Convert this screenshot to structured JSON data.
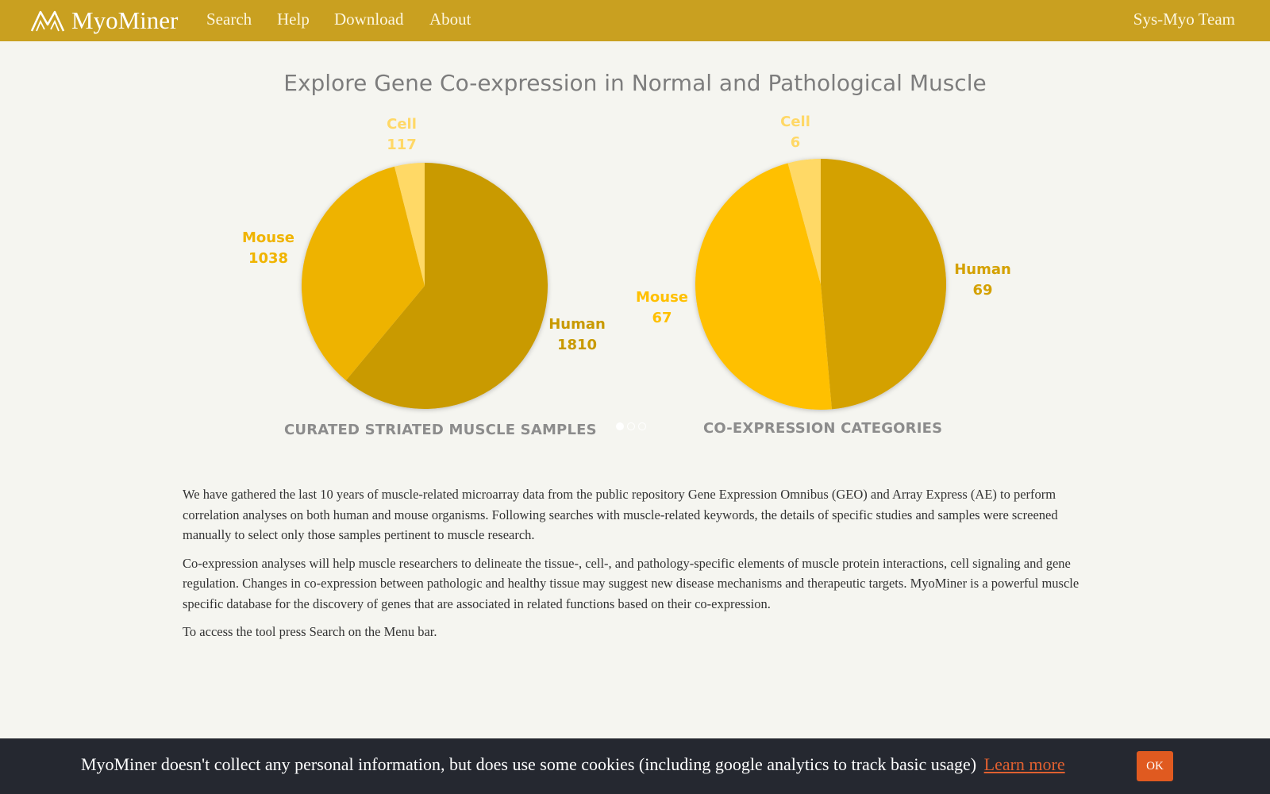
{
  "navbar": {
    "brand": "MyoMiner",
    "links": [
      "Search",
      "Help",
      "Download",
      "About"
    ],
    "team": "Sys-Myo Team"
  },
  "headline": "Explore Gene Co-expression in Normal and Pathological Muscle",
  "chart_data": [
    {
      "type": "pie",
      "title": "CURATED STRIATED MUSCLE SAMPLES",
      "categories": [
        "Human",
        "Mouse",
        "Cell"
      ],
      "values": [
        1810,
        1038,
        117
      ],
      "colors": [
        "#c99a00",
        "#eeb300",
        "#ffd966"
      ]
    },
    {
      "type": "pie",
      "title": "CO-EXPRESSION CATEGORIES",
      "categories": [
        "Human",
        "Mouse",
        "Cell"
      ],
      "values": [
        69,
        67,
        6
      ],
      "colors": [
        "#d4a100",
        "#ffc000",
        "#ffd966"
      ]
    }
  ],
  "carousel": {
    "slides": 3,
    "active": 1
  },
  "intro": {
    "paragraphs": [
      "We have gathered the last 10 years of muscle-related microarray data from the public repository Gene Expression Omnibus (GEO) and Array Express (AE) to perform correlation analyses on both human and mouse organisms. Following searches with muscle-related keywords, the details of specific studies and samples were screened manually to select only those samples pertinent to muscle research.",
      "Co-expression analyses will help muscle researchers to delineate the tissue-, cell-, and pathology-specific elements of muscle protein interactions, cell signaling and gene regulation. Changes in co-expression between pathologic and healthy tissue may suggest new disease mechanisms and therapeutic targets. MyoMiner is a powerful muscle specific database for the discovery of genes that are associated in related functions based on their co-expression.",
      "To access the tool press Search on the Menu bar."
    ]
  },
  "cookie": {
    "text": "MyoMiner doesn't collect any personal information, but does use some cookies (including google analytics to track basic usage)",
    "link": "Learn more",
    "button": "OK"
  }
}
